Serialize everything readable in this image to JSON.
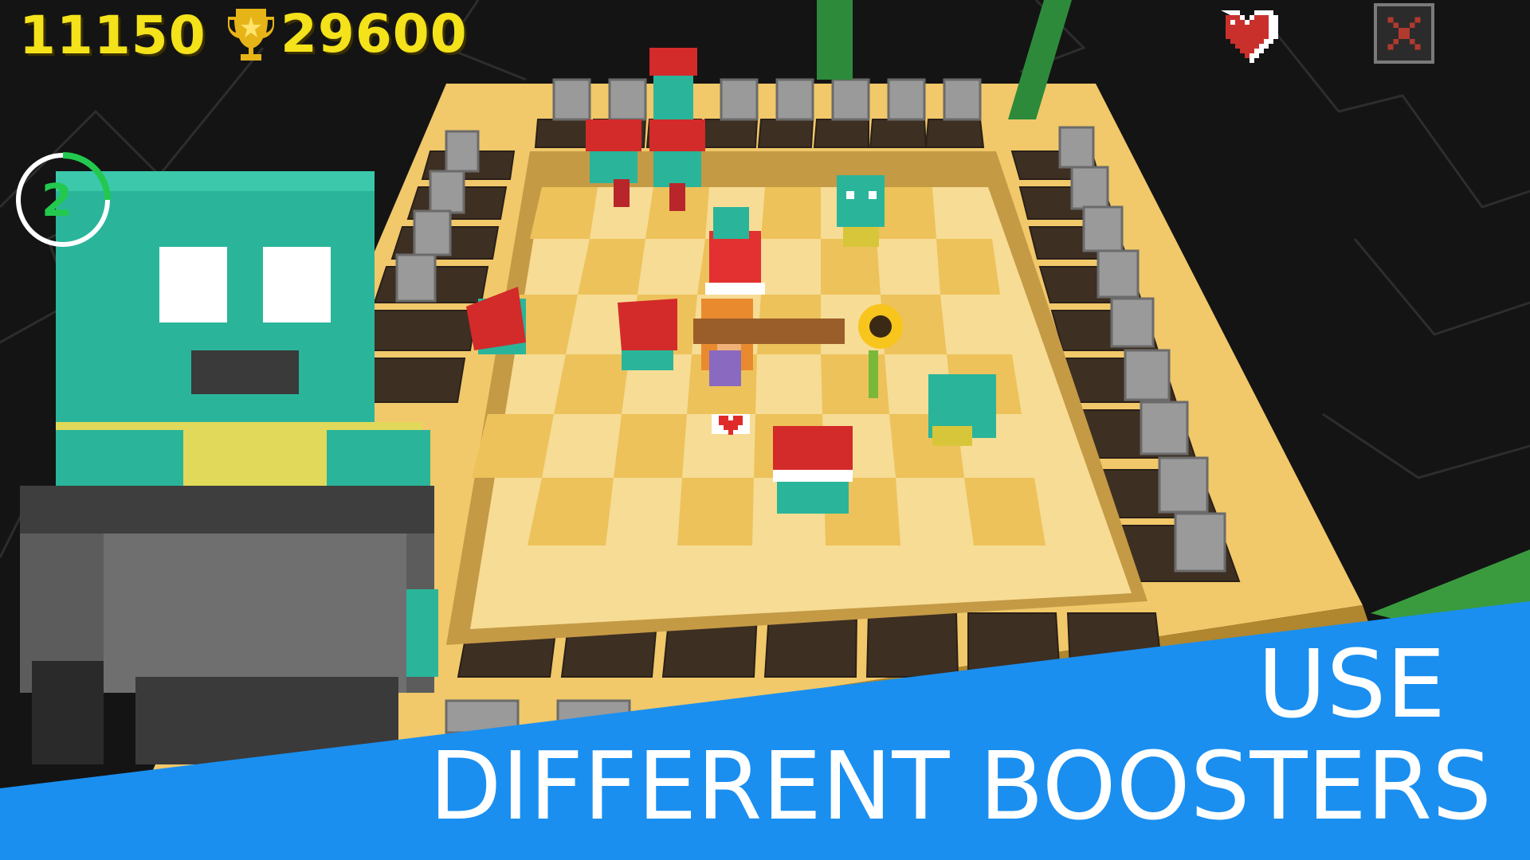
{
  "hud": {
    "score": "11150",
    "best_score": "29600",
    "timer_value": "2",
    "icons": [
      "trophy-icon",
      "heart-icon",
      "close-icon"
    ]
  },
  "banner": {
    "line1": "USE",
    "line2": "DIFFERENT BOOSTERS",
    "color": "#1a8ff0"
  },
  "colors": {
    "hud_text": "#f4e21a",
    "floor_light": "#f6dc95",
    "floor_dark": "#edc25a",
    "zombie": "#2ab59a",
    "santa_hat": "#d32a2a",
    "timer_ring": "#23c94f"
  }
}
